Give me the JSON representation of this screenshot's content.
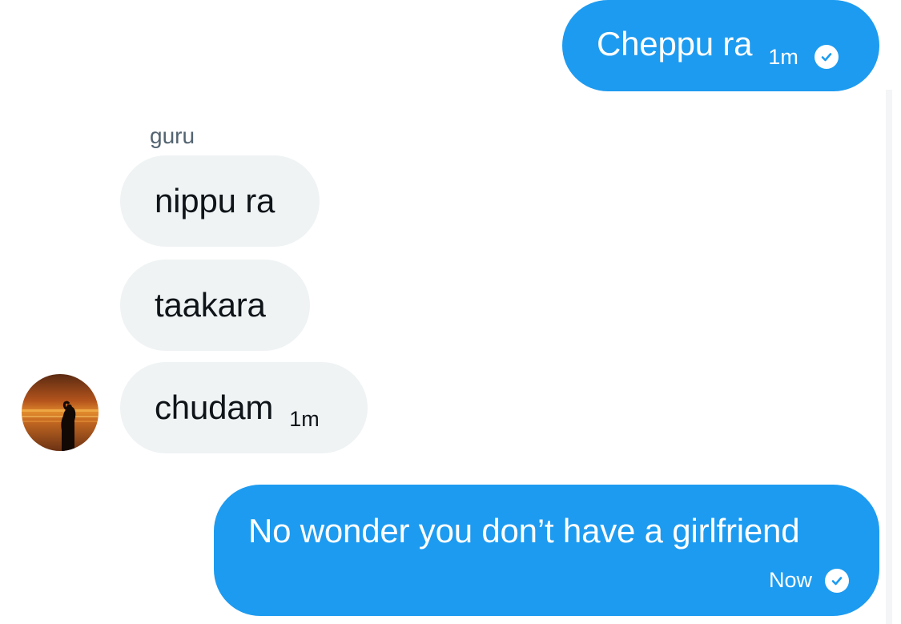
{
  "conversation": {
    "messages": [
      {
        "direction": "outgoing",
        "text": "Cheppu ra",
        "time": "1m",
        "status_icon": "check-circle-icon"
      },
      {
        "direction": "incoming",
        "sender": "guru",
        "text": "nippu ra"
      },
      {
        "direction": "incoming",
        "text": "taakara"
      },
      {
        "direction": "incoming",
        "text": "chudam",
        "time": "1m",
        "avatar": "sunset-beach-silhouette-avatar"
      },
      {
        "direction": "outgoing",
        "text": "No wonder you don’t have a girlfriend",
        "time": "Now",
        "status_icon": "check-circle-icon"
      }
    ]
  },
  "colors": {
    "outgoing_bubble": "#1d9bf0",
    "incoming_bubble": "#eff3f4",
    "incoming_text": "#0f1419",
    "sender_name": "#536471",
    "background": "#ffffff"
  }
}
